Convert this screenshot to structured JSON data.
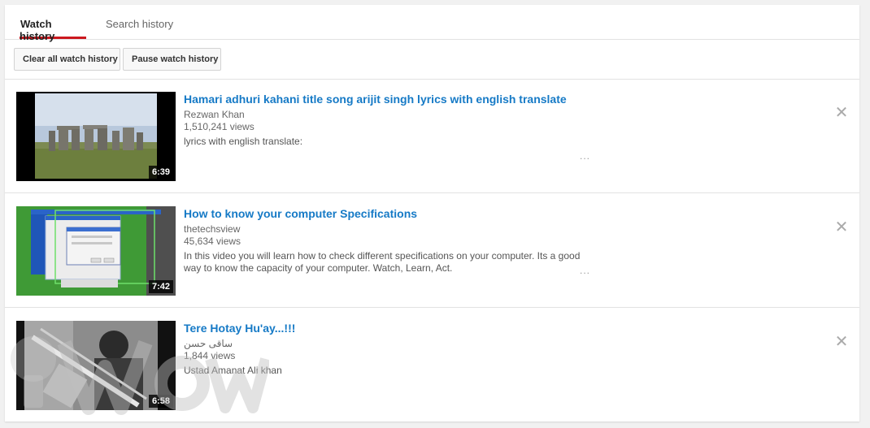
{
  "tabs": [
    {
      "label": "Watch history",
      "active": true
    },
    {
      "label": "Search history",
      "active": false
    }
  ],
  "actions": {
    "clear_label": "Clear all watch history",
    "pause_label": "Pause watch history"
  },
  "videos": [
    {
      "title": "Hamari adhuri kahani title song arijit singh lyrics with english translate",
      "channel": "Rezwan Khan",
      "views": "1,510,241 views",
      "description": "lyrics with english translate:",
      "duration": "6:39",
      "remove_icon": "close-icon"
    },
    {
      "title": "How to know your computer Specifications",
      "channel": "thetechsview",
      "views": "45,634 views",
      "description": "In this video you will learn how to check different specifications on your computer. Its a good way to know the capacity of your computer. Watch, Learn, Act.",
      "duration": "7:42",
      "remove_icon": "close-icon"
    },
    {
      "title": "Tere Hotay Hu'ay...!!!",
      "channel": "ساقی حسن",
      "views": "1,844 views",
      "description": "Ustad Amanat Ali khan",
      "duration": "6:58",
      "remove_icon": "close-icon"
    }
  ],
  "ellipsis": "...",
  "colors": {
    "title_link": "#167ac6",
    "active_tab_underline": "#cc181e"
  }
}
